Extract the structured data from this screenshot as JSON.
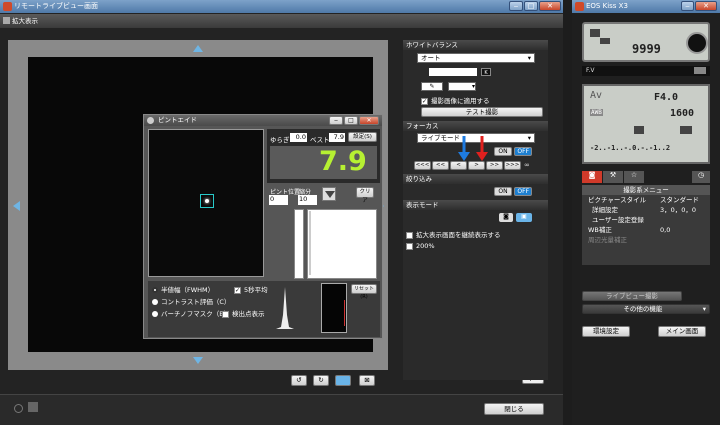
{
  "main_window": {
    "title": "リモートライブビュー画面",
    "sub_title": "拡大表示",
    "close_label": "閉じる",
    "expsim_label": "ExpSIM"
  },
  "white_balance": {
    "header": "ホワイトバランス",
    "mode": "オート",
    "apply_checkbox": "撮影画像に適用する",
    "test_button": "テスト撮影"
  },
  "focus": {
    "header": "フォーカス",
    "mode": "ライブモード",
    "on": "ON",
    "off": "OFF",
    "steps": [
      "<<<",
      "<<",
      "<",
      ">",
      ">>",
      ">>>"
    ],
    "inf": "∞"
  },
  "aperture": {
    "header": "絞り込み",
    "on": "ON",
    "off": "OFF"
  },
  "display_mode": {
    "header": "表示モード",
    "continuous_checkbox": "拡大表示画面を継続表示する",
    "zoom_checkbox": "200%"
  },
  "focus_aid": {
    "title": "ピントエイド",
    "sway_label": "ゆらぎ",
    "sway_value": "0.0",
    "best_label": "ベスト",
    "best_value": "7.9",
    "setting_button": "設定(S)",
    "big_value": "7.9",
    "pos_label": "ピント位置",
    "reduce_label": "縮分",
    "pos_value": "0",
    "reduce_value": "10",
    "clear_button": "クリア",
    "radio_fwhm": "半値幅（FWHM）",
    "radio_contrast": "コントラスト評価（C）",
    "radio_bahtinov": "バーチノフマスク（B）",
    "avg_checkbox": "5秒平均",
    "detect_checkbox": "検出点表示",
    "reset_button": "リセット(R)"
  },
  "camera_window": {
    "title": "EOS Kiss X3",
    "shots": "9999",
    "fv_label": "F.V",
    "mode": "Av",
    "aperture": "F4.0",
    "iso": "1600",
    "awb": "AWB",
    "scale": "-2..-1..-.0.-.-1..2",
    "scale2": "-2..1..0..1..2",
    "menu_title": "撮影系メニュー",
    "menu_items": [
      {
        "label": "ピクチャースタイル",
        "value": "スタンダード"
      },
      {
        "label": "詳細設定",
        "value": "3，0，0，0"
      },
      {
        "label": "ユーザー設定登録",
        "value": ""
      },
      {
        "label": "WB補正",
        "value": "0,0"
      },
      {
        "label": "周辺光量補正",
        "value": ""
      }
    ],
    "liveview_button": "ライブビュー撮影",
    "other_button": "その他の機能",
    "settings_button": "環境設定",
    "main_button": "メイン画面"
  }
}
